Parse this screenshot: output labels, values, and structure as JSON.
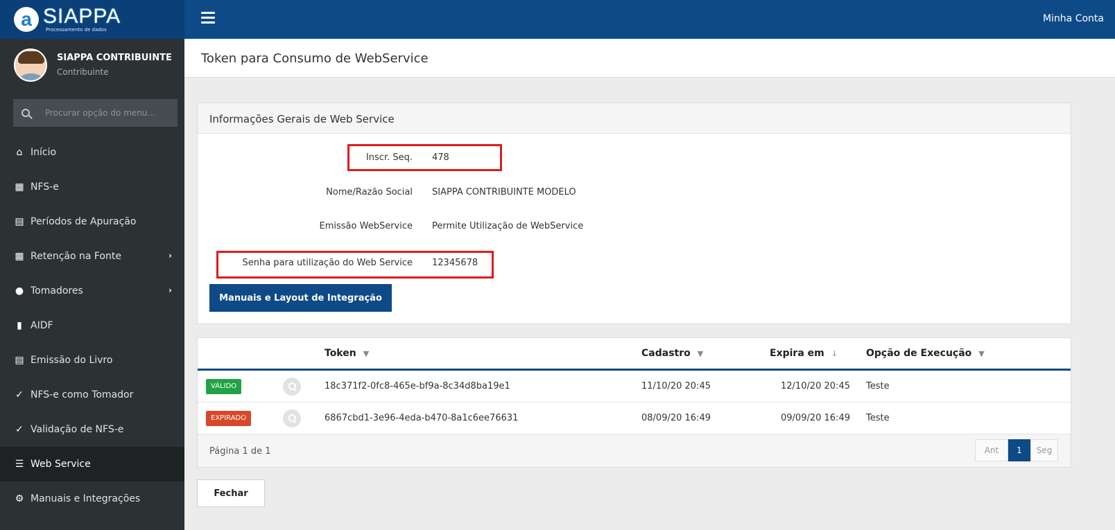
{
  "topbar": {
    "logo_name": "SIAPPA",
    "logo_sub": "Processamento de dados",
    "account_label": "Minha Conta"
  },
  "user": {
    "name": "SIAPPA CONTRIBUINTE",
    "role": "Contribuinte"
  },
  "search": {
    "placeholder": "Procurar opção do menu..."
  },
  "menu": [
    {
      "label": "Início",
      "icon": "home-icon",
      "glyph": "⌂"
    },
    {
      "label": "NFS-e",
      "icon": "invoice-icon",
      "glyph": "▦"
    },
    {
      "label": "Períodos de Apuração",
      "icon": "calendar-icon",
      "glyph": "▤"
    },
    {
      "label": "Retenção na Fonte",
      "icon": "invoice-icon",
      "glyph": "▦"
    },
    {
      "label": "Tomadores",
      "icon": "user-icon",
      "glyph": "●"
    },
    {
      "label": "AIDF",
      "icon": "bookmark-icon",
      "glyph": "▮"
    },
    {
      "label": "Emissão do Livro",
      "icon": "book-icon",
      "glyph": "▤"
    },
    {
      "label": "NFS-e como Tomador",
      "icon": "check-circle-icon",
      "glyph": "✓"
    },
    {
      "label": "Validação de NFS-e",
      "icon": "check-circle-icon",
      "glyph": "✓"
    },
    {
      "label": "Web Service",
      "icon": "list-check-icon",
      "glyph": "☰"
    },
    {
      "label": "Manuais e Integrações",
      "icon": "gears-icon",
      "glyph": "⚙"
    }
  ],
  "page": {
    "title": "Token para Consumo de WebService"
  },
  "info_panel": {
    "title": "Informações Gerais de Web Service",
    "inscr_label": "Inscr. Seq.",
    "inscr_value": "478",
    "nome_label": "Nome/Razão Social",
    "nome_value": "SIAPPA CONTRIBUINTE MODELO",
    "emissao_label": "Emissão WebService",
    "emissao_value": "Permite Utilização de WebService",
    "senha_label": "Senha para utilização do Web Service",
    "senha_value": "12345678",
    "manuals_button": "Manuais e Layout de Integração"
  },
  "grid": {
    "columns": {
      "token": "Token",
      "cadastro": "Cadastro",
      "expira": "Expira em",
      "opcao": "Opção de Execução"
    },
    "rows": [
      {
        "status": "VÁLIDO",
        "token": "18c371f2-0fc8-465e-bf9a-8c34d8ba19e1",
        "cadastro": "11/10/20 20:45",
        "expira": "12/10/20 20:45",
        "opcao": "Teste"
      },
      {
        "status": "EXPIRADO",
        "token": "6867cbd1-3e96-4eda-b470-8a1c6ee76631",
        "cadastro": "08/09/20 16:49",
        "expira": "09/09/20 16:49",
        "opcao": "Teste"
      }
    ],
    "page_info": "Página 1 de 1",
    "pager": {
      "prev": "Ant",
      "current": "1",
      "next": "Seg"
    }
  },
  "close_button": "Fechar",
  "colors": {
    "brand_blue": "#0d4a87",
    "sidebar_bg": "#2c3133",
    "valid_green": "#21a345",
    "expired_red": "#d9472b",
    "highlight_red": "#e01b1b"
  }
}
